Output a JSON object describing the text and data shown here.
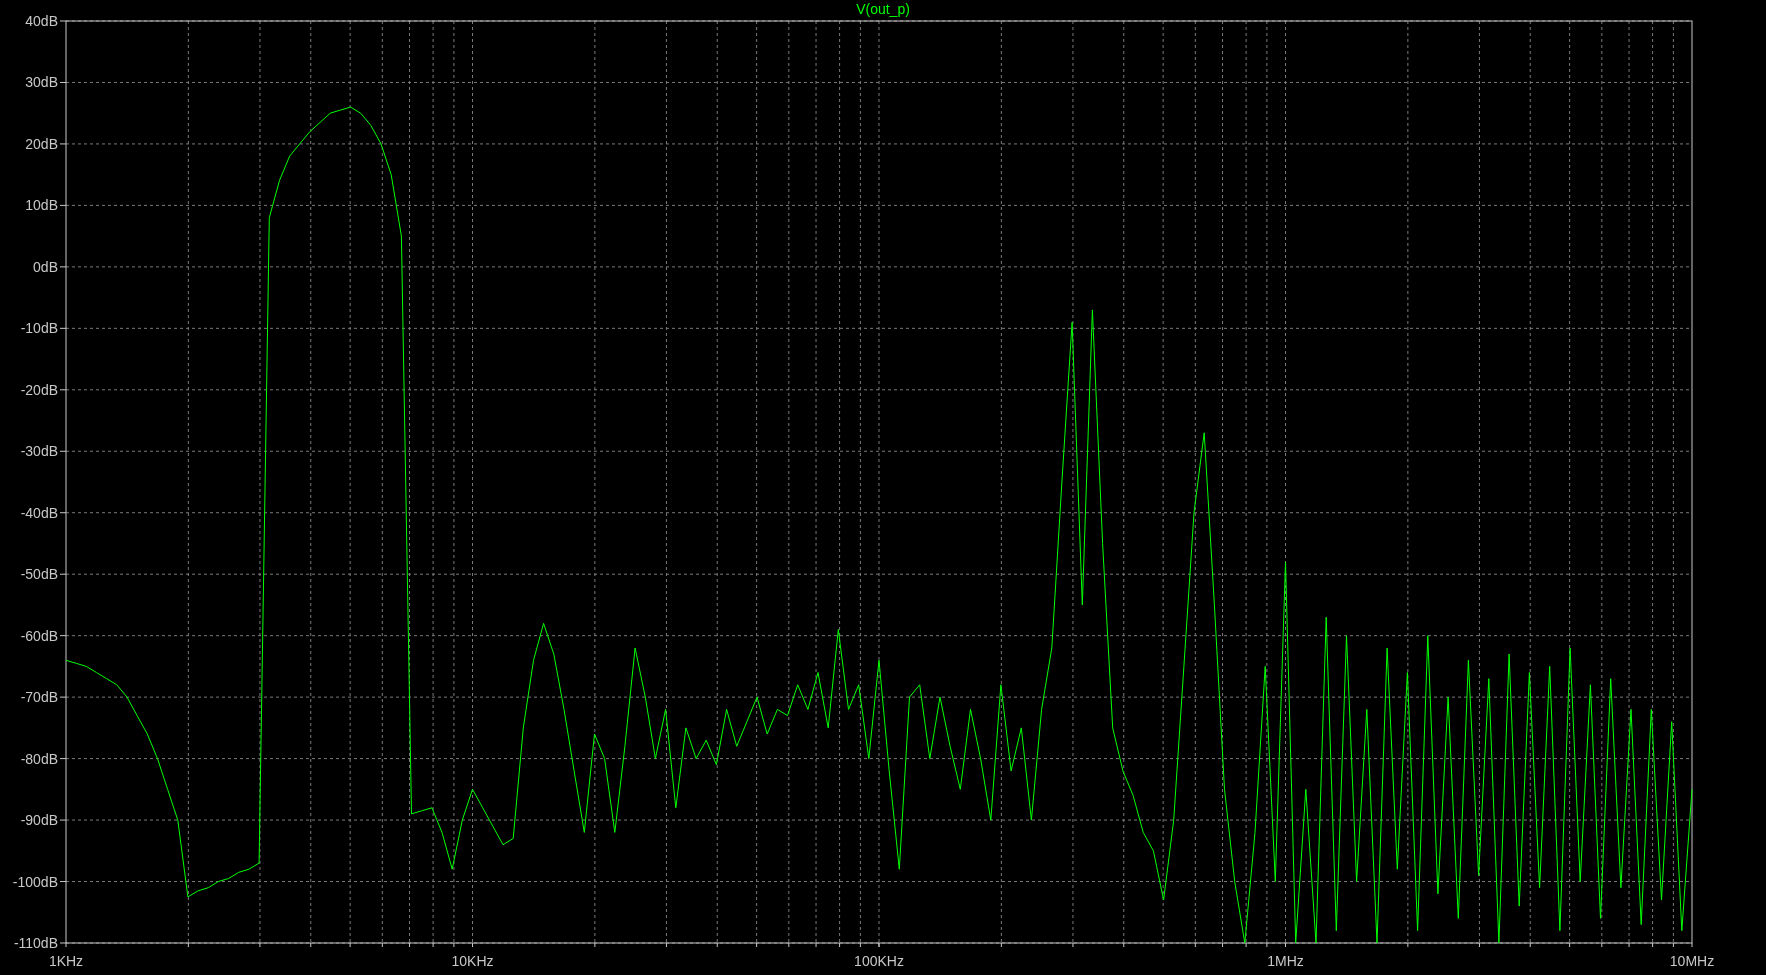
{
  "chart_data": {
    "type": "line",
    "title": "V(out_p)",
    "grid": true,
    "categories": [
      "1KHz",
      null,
      null,
      null,
      null,
      null,
      null,
      null,
      null,
      null,
      null,
      null,
      null,
      null,
      null,
      null,
      null,
      null,
      null,
      null,
      null,
      null,
      null,
      null,
      null,
      null,
      null,
      null,
      null,
      null,
      null,
      null,
      null,
      null,
      null,
      null,
      null,
      null,
      null,
      null,
      "10KHz",
      null,
      null,
      null,
      null,
      null,
      null,
      null,
      null,
      null,
      null,
      null,
      null,
      null,
      null,
      null,
      null,
      null,
      null,
      null,
      null,
      null,
      null,
      null,
      null,
      null,
      null,
      null,
      null,
      null,
      null,
      null,
      null,
      null,
      null,
      null,
      null,
      null,
      null,
      null,
      "100KHz",
      null,
      null,
      null,
      null,
      null,
      null,
      null,
      null,
      null,
      null,
      null,
      null,
      null,
      null,
      null,
      null,
      null,
      null,
      null,
      null,
      null,
      null,
      null,
      null,
      null,
      null,
      null,
      null,
      null,
      null,
      null,
      null,
      null,
      null,
      null,
      null,
      null,
      null,
      null,
      "1MHz",
      null,
      null,
      null,
      null,
      null,
      null,
      null,
      null,
      null,
      null,
      null,
      null,
      null,
      null,
      null,
      null,
      null,
      null,
      null,
      null,
      null,
      null,
      null,
      null,
      null,
      null,
      null,
      null,
      null,
      null,
      null,
      null,
      null,
      null,
      null,
      null,
      null,
      null,
      null,
      "10MHz"
    ],
    "series": [
      {
        "color": "#00ff00",
        "values": [
          -64,
          -64.5,
          -65,
          -66,
          -67,
          -68,
          -70,
          -73,
          -76,
          -80,
          -85,
          -90,
          -102.5,
          -101.5,
          -101,
          -100,
          -99.5,
          -98.5,
          -98,
          -97,
          8,
          14,
          18,
          20,
          22,
          23.5,
          25,
          25.5,
          26,
          25,
          23,
          20,
          15,
          5,
          -89,
          -88.5,
          -88,
          -92,
          -98,
          -90,
          -85,
          -88,
          -91,
          -94,
          -93,
          -75,
          -64,
          -58,
          -63,
          -72,
          -82,
          -92,
          -76,
          -80,
          -92,
          -78,
          -62,
          -70,
          -80,
          -72,
          -88,
          -75,
          -80,
          -77,
          -81,
          -72,
          -78,
          -74,
          -70,
          -76,
          -72,
          -73,
          -68,
          -72,
          -66,
          -75,
          -59,
          -72,
          -68,
          -80,
          -64,
          -82,
          -98,
          -70,
          -68,
          -80,
          -70,
          -78,
          -85,
          -72,
          -80,
          -90,
          -68,
          -82,
          -75,
          -90,
          -72,
          -62,
          -35,
          -9,
          -55,
          -7,
          -45,
          -75,
          -82,
          -86,
          -92,
          -95,
          -103,
          -90,
          -65,
          -40,
          -27,
          -55,
          -85,
          -100,
          -110,
          -92,
          -65,
          -100,
          -48,
          -110,
          -85,
          -110,
          -57,
          -108,
          -60,
          -100,
          -72,
          -110,
          -62,
          -98,
          -66,
          -108,
          -60,
          -102,
          -70,
          -106,
          -64,
          -99,
          -67,
          -110,
          -63,
          -104,
          -66,
          -101,
          -65,
          -108,
          -62,
          -100,
          -68,
          -106,
          -67,
          -101,
          -72,
          -107,
          -72,
          -103,
          -74,
          -108,
          -85
        ]
      }
    ],
    "ylim": [
      -110,
      40
    ],
    "yticks": [
      {
        "value": 40,
        "label": "40dB"
      },
      {
        "value": 30,
        "label": "30dB"
      },
      {
        "value": 20,
        "label": "20dB"
      },
      {
        "value": 10,
        "label": "10dB"
      },
      {
        "value": 0,
        "label": "0dB"
      },
      {
        "value": -10,
        "label": "-10dB"
      },
      {
        "value": -20,
        "label": "-20dB"
      },
      {
        "value": -30,
        "label": "-30dB"
      },
      {
        "value": -40,
        "label": "-40dB"
      },
      {
        "value": -50,
        "label": "-50dB"
      },
      {
        "value": -60,
        "label": "-60dB"
      },
      {
        "value": -70,
        "label": "-70dB"
      },
      {
        "value": -80,
        "label": "-80dB"
      },
      {
        "value": -90,
        "label": "-90dB"
      },
      {
        "value": -100,
        "label": "-100dB"
      },
      {
        "value": -110,
        "label": "-110dB"
      }
    ]
  }
}
